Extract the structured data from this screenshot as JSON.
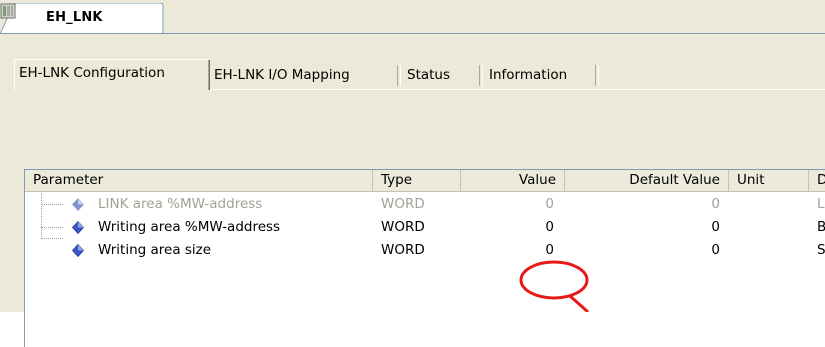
{
  "document_tab": {
    "title": "EH_LNK"
  },
  "subtabs": [
    {
      "label": "EH-LNK Configuration",
      "active": true
    },
    {
      "label": "EH-LNK I/O Mapping",
      "active": false
    },
    {
      "label": "Status",
      "active": false
    },
    {
      "label": "Information",
      "active": false
    }
  ],
  "grid": {
    "columns": {
      "parameter": "Parameter",
      "type": "Type",
      "value": "Value",
      "default_value": "Default Value",
      "unit": "Unit",
      "description": "D"
    },
    "rows": [
      {
        "parameter": "LINK area %MW-address",
        "type": "WORD",
        "value": "0",
        "default_value": "0",
        "unit": "",
        "description": "L",
        "disabled": true
      },
      {
        "parameter": "Writing area %MW-address",
        "type": "WORD",
        "value": "0",
        "default_value": "0",
        "unit": "",
        "description": "B",
        "disabled": false
      },
      {
        "parameter": "Writing area size",
        "type": "WORD",
        "value": "0",
        "default_value": "0",
        "unit": "",
        "description": "S",
        "disabled": false
      }
    ]
  },
  "colors": {
    "annotation_red": "#e8191a",
    "panel_bg": "#ece9d8",
    "icon_blue": "#3a57c8"
  },
  "icons": {
    "document": "device-module-icon",
    "parameter": "parameter-diamond-icon"
  }
}
